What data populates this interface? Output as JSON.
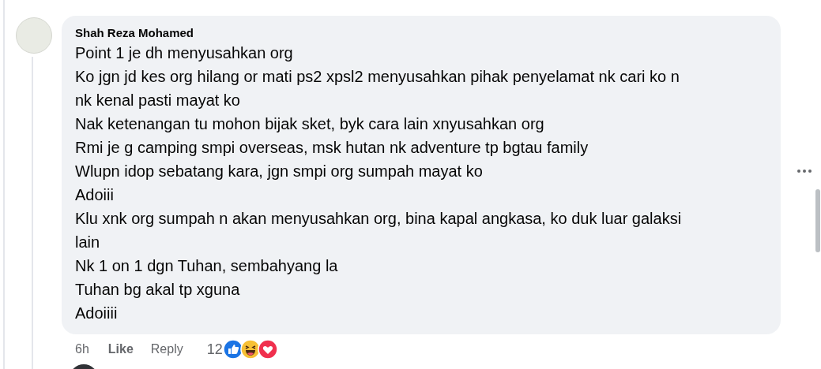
{
  "comment": {
    "author": "Shah Reza Mohamed",
    "lines": [
      "Point 1 je dh menyusahkan org",
      "Ko jgn jd kes org hilang or mati ps2 xpsl2 menyusahkan pihak penyelamat nk cari ko n nk kenal pasti mayat ko",
      "Nak ketenangan tu mohon bijak sket, byk cara lain xnyusahkan org",
      "Rmi je g camping smpi overseas, msk hutan nk adventure tp bgtau family",
      "Wlupn idop sebatang kara, jgn smpi org sumpah mayat ko",
      "Adoiii",
      "Klu xnk org sumpah n akan menyusahkan org, bina kapal angkasa, ko duk luar galaksi lain",
      "Nk 1 on 1 dgn Tuhan, sembahyang la",
      "Tuhan bg akal tp xguna",
      "Adoiiii"
    ],
    "time": "6h",
    "like": "Like",
    "reply": "Reply",
    "reaction_count": "12",
    "reactions": [
      {
        "kind": "like"
      },
      {
        "kind": "haha"
      },
      {
        "kind": "love"
      }
    ]
  }
}
